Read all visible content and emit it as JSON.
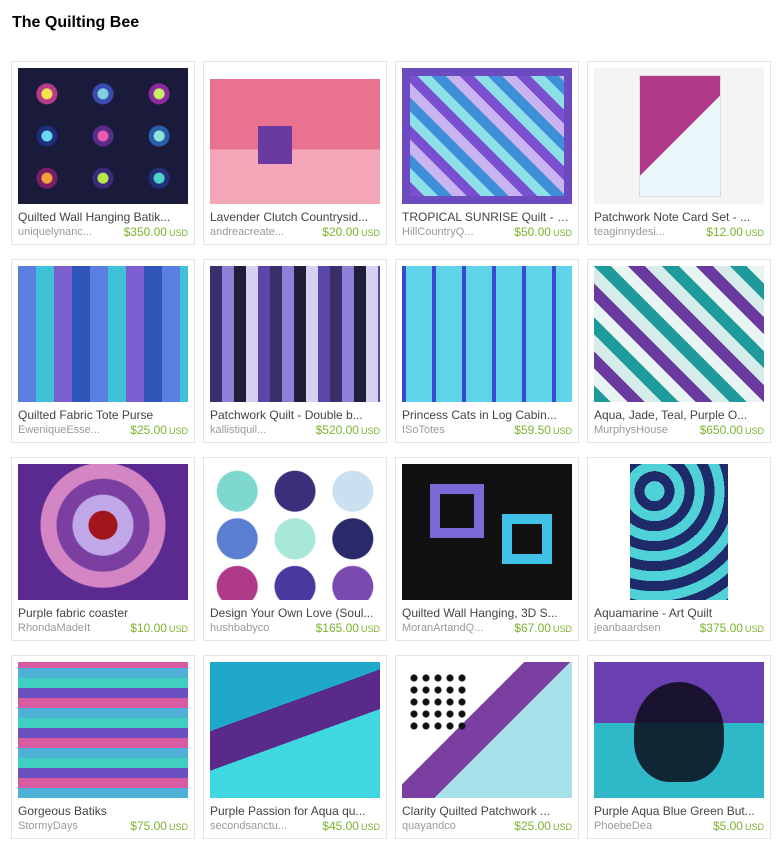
{
  "title": "The Quilting Bee",
  "currency": "USD",
  "items": [
    {
      "title": "Quilted Wall Hanging Batik...",
      "shop": "uniquelynanc...",
      "price": "$350.00",
      "thumb": "t-compass"
    },
    {
      "title": "Lavender Clutch Countrysid...",
      "shop": "andreacreate...",
      "price": "$20.00",
      "thumb": "t-clutch"
    },
    {
      "title": "TROPICAL SUNRISE Quilt - P...",
      "shop": "HillCountryQ...",
      "price": "$50.00",
      "thumb": "t-tropical"
    },
    {
      "title": "Patchwork Note Card Set - ...",
      "shop": "teaginnydesi...",
      "price": "$12.00",
      "thumb": "t-notecard"
    },
    {
      "title": "Quilted Fabric Tote Purse",
      "shop": "EweniqueEsse...",
      "price": "$25.00",
      "thumb": "t-tote"
    },
    {
      "title": "Patchwork Quilt - Double b...",
      "shop": "kallistiquil...",
      "price": "$520.00",
      "thumb": "t-logcabin"
    },
    {
      "title": "Princess Cats in Log Cabin...",
      "shop": "ISoTotes",
      "price": "$59.50",
      "thumb": "t-princess"
    },
    {
      "title": "Aqua, Jade, Teal, Purple O...",
      "shop": "MurphysHouse",
      "price": "$650.00",
      "thumb": "t-aqua"
    },
    {
      "title": "Purple fabric coaster",
      "shop": "RhondaMadeIt",
      "price": "$10.00",
      "thumb": "t-coaster"
    },
    {
      "title": "Design Your Own Love (Soul...",
      "shop": "hushbabyco",
      "price": "$165.00",
      "thumb": "t-love"
    },
    {
      "title": "Quilted Wall Hanging, 3D S...",
      "shop": "MoranArtandQ...",
      "price": "$67.00",
      "thumb": "t-3dsquares"
    },
    {
      "title": "Aquamarine - Art Quilt",
      "shop": "jeanbaardsen",
      "price": "$375.00",
      "thumb": "t-aquamarine"
    },
    {
      "title": "Gorgeous Batiks",
      "shop": "StormyDays",
      "price": "$75.00",
      "thumb": "t-batiks"
    },
    {
      "title": "Purple Passion for Aqua qu...",
      "shop": "secondsanctu...",
      "price": "$45.00",
      "thumb": "t-passion"
    },
    {
      "title": "Clarity Quilted Patchwork ...",
      "shop": "quayandco",
      "price": "$25.00",
      "thumb": "t-clarity"
    },
    {
      "title": "Purple Aqua Blue Green But...",
      "shop": "PhoebeDea",
      "price": "$5.00",
      "thumb": "t-butterfly"
    }
  ]
}
